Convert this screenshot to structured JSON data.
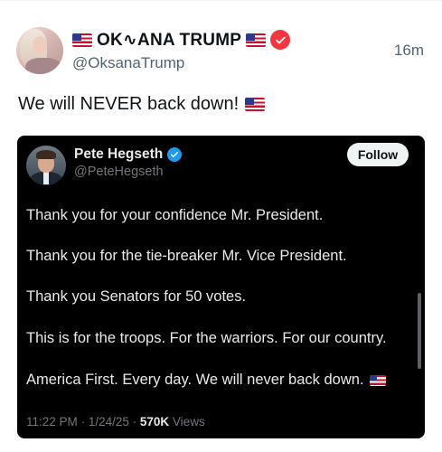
{
  "post": {
    "display_name": "OK∿ANA TRUMP",
    "handle": "@OksanaTrump",
    "timestamp": "16m",
    "text": "We will NEVER back down!",
    "flag_icon": "us-flag-icon",
    "verified_color": "#f4363e"
  },
  "quoted": {
    "name": "Pete Hegseth",
    "handle": "@PeteHegseth",
    "follow_label": "Follow",
    "verified_color": "#1d9bf0",
    "lines": [
      "Thank you for your confidence Mr. President.",
      "Thank you for the tie-breaker Mr. Vice President.",
      "Thank you Senators for 50 votes.",
      "This is for the troops. For the warriors. For our country.",
      "America First. Every day. We will never back down."
    ],
    "meta": {
      "time": "11:22 PM",
      "date": "1/24/25",
      "views_count": "570K",
      "views_label": "Views"
    }
  }
}
